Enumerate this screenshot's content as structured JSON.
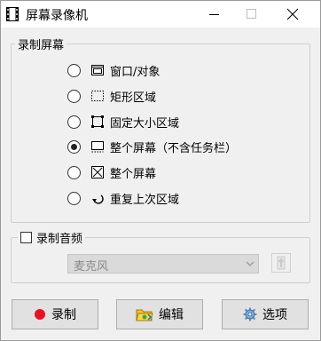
{
  "window": {
    "title": "屏幕录像机"
  },
  "screen_group": {
    "legend": "录制屏幕",
    "options": [
      {
        "label": "窗口/对象",
        "icon": "window-object-icon",
        "selected": false
      },
      {
        "label": "矩形区域",
        "icon": "rectangle-region-icon",
        "selected": false
      },
      {
        "label": "固定大小区域",
        "icon": "fixed-size-region-icon",
        "selected": false
      },
      {
        "label": "整个屏幕（不含任务栏）",
        "icon": "screen-no-taskbar-icon",
        "selected": true
      },
      {
        "label": "整个屏幕",
        "icon": "full-screen-icon",
        "selected": false
      },
      {
        "label": "重复上次区域",
        "icon": "repeat-region-icon",
        "selected": false
      }
    ]
  },
  "audio_group": {
    "legend": "录制音频",
    "checked": false,
    "device": "麦克风"
  },
  "buttons": {
    "record": "录制",
    "edit": "编辑",
    "options": "选项"
  },
  "colors": {
    "record_dot": "#e81123",
    "window_bg": "#f0f0f0"
  }
}
